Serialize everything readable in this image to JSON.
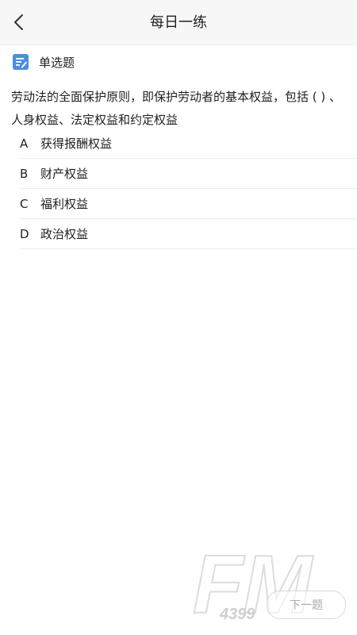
{
  "header": {
    "title": "每日一练",
    "back_icon": "chevron-left-icon"
  },
  "question_type": {
    "icon": "edit-note-icon",
    "label": "单选题",
    "accent_color": "#4a8fdc"
  },
  "question": {
    "lines": [
      "劳动法的全面保护原则，即保护劳动者的基本权益，包括 ( ) 、",
      "人身权益、法定权益和约定权益"
    ]
  },
  "options": [
    {
      "letter": "A",
      "text": "获得报酬权益"
    },
    {
      "letter": "B",
      "text": "财产权益"
    },
    {
      "letter": "C",
      "text": "福利权益"
    },
    {
      "letter": "D",
      "text": "政治权益"
    }
  ],
  "footer": {
    "next_label": "下一题"
  },
  "watermark": {
    "brand": "FM",
    "sub": "4399"
  }
}
